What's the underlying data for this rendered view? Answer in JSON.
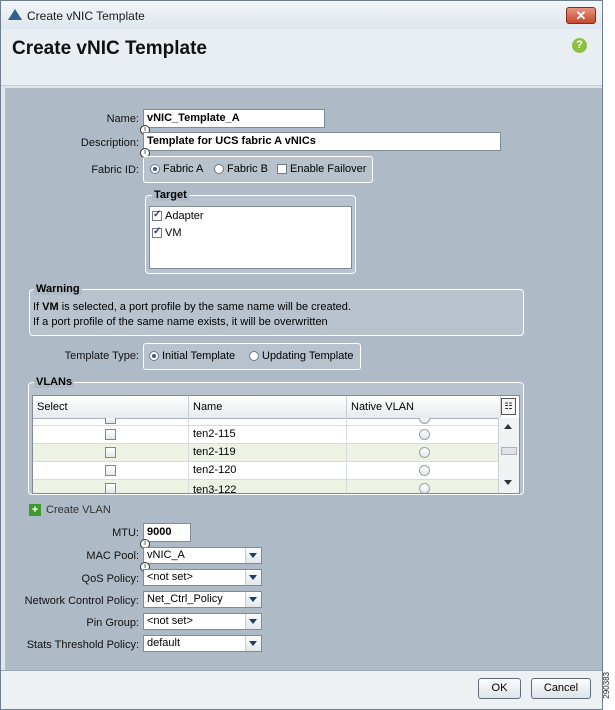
{
  "window": {
    "title": "Create vNIC Template",
    "close_glyph": "✕"
  },
  "header": {
    "title": "Create vNIC Template",
    "help_glyph": "?"
  },
  "form": {
    "name_label": "Name:",
    "name_value": "vNIC_Template_A",
    "description_label": "Description:",
    "description_value": "Template for UCS fabric A vNICs",
    "fabric_label": "Fabric ID:",
    "fabric_a": "Fabric A",
    "fabric_b": "Fabric B",
    "enable_failover": "Enable Failover",
    "fabric_selected": "Fabric A",
    "failover_checked": false,
    "target_title": "Target",
    "target_items": [
      {
        "label": "Adapter",
        "checked": true
      },
      {
        "label": "VM",
        "checked": true
      }
    ],
    "warning_title": "Warning",
    "warning_line1_pre": "If ",
    "warning_line1_bold": "VM",
    "warning_line1_post": " is selected, a port profile by the same name will be created.",
    "warning_line2": "If a port profile of the same name exists, it will be overwritten",
    "template_type_label": "Template Type:",
    "initial_template": "Initial Template",
    "updating_template": "Updating Template",
    "template_type_selected": "Initial Template"
  },
  "vlans": {
    "title": "VLANs",
    "columns": [
      "Select",
      "Name",
      "Native VLAN"
    ],
    "rows": [
      {
        "name": "ten2-115"
      },
      {
        "name": "ten2-119"
      },
      {
        "name": "ten2-120"
      },
      {
        "name": "ten3-122"
      }
    ],
    "create_vlan": "Create VLAN"
  },
  "settings": {
    "mtu_label": "MTU:",
    "mtu_value": "9000",
    "mac_pool_label": "MAC Pool:",
    "mac_pool_value": "vNIC_A",
    "qos_label": "QoS Policy:",
    "qos_value": "<not set>",
    "ncp_label": "Network Control Policy:",
    "ncp_value": "Net_Ctrl_Policy",
    "pin_label": "Pin Group:",
    "pin_value": "<not set>",
    "stats_label": "Stats Threshold Policy:",
    "stats_value": "default"
  },
  "footer": {
    "ok": "OK",
    "cancel": "Cancel"
  },
  "side_code": "290383",
  "colors": {
    "panel": "#aebac5",
    "header": "#e9eef3",
    "accent": "#2d5c8a",
    "help": "#8cbf3f",
    "close": "#c44a2f"
  }
}
